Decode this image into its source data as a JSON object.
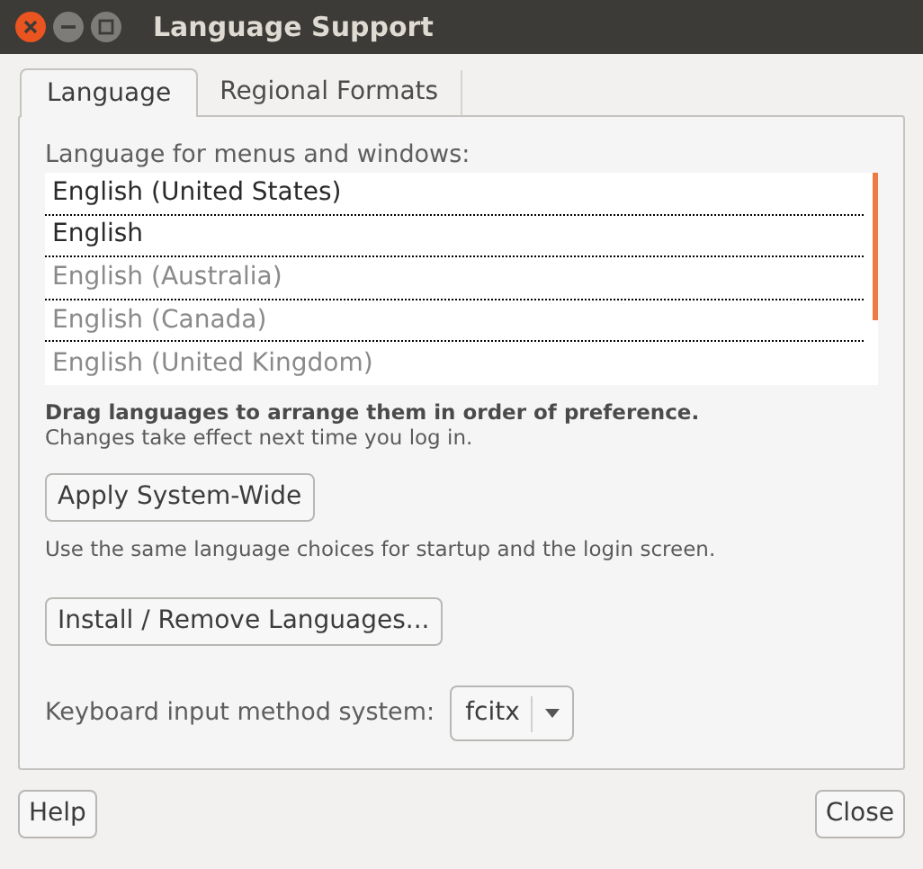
{
  "window": {
    "title": "Language Support"
  },
  "tabs": [
    {
      "label": "Language",
      "selected": true
    },
    {
      "label": "Regional Formats",
      "selected": false
    }
  ],
  "language_list": {
    "label": "Language for menus and windows:",
    "items": [
      {
        "name": "English (United States)",
        "disabled": false
      },
      {
        "name": "English",
        "disabled": false
      },
      {
        "name": "English (Australia)",
        "disabled": true
      },
      {
        "name": "English (Canada)",
        "disabled": true
      },
      {
        "name": "English (United Kingdom)",
        "disabled": true
      }
    ]
  },
  "drag_hint": "Drag languages to arrange them in order of preference.",
  "changes_note": "Changes take effect next time you log in.",
  "apply_button": "Apply System-Wide",
  "apply_note": "Use the same language choices for startup and the login screen.",
  "install_button": "Install / Remove Languages...",
  "input_method": {
    "label": "Keyboard input method system:",
    "value": "fcitx"
  },
  "buttons": [
    "Help",
    "Close"
  ]
}
